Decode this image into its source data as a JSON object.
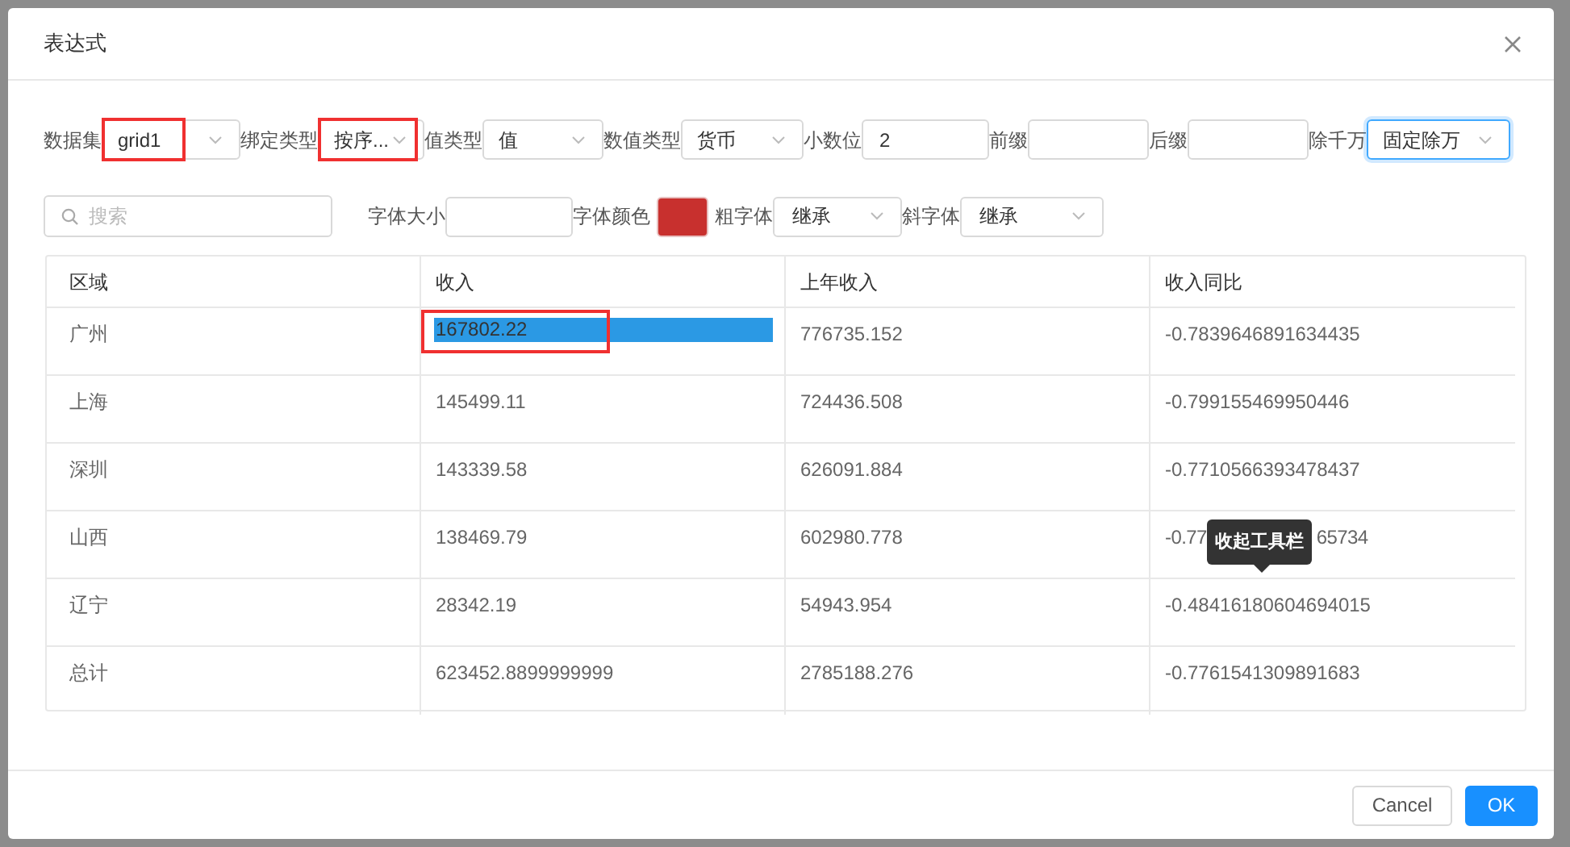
{
  "dialog": {
    "title": "表达式"
  },
  "form_row_1": [
    {
      "label": "数据集",
      "kind": "select",
      "value": "grid1",
      "highlighted": true,
      "focused": false
    },
    {
      "label": "绑定类型",
      "kind": "select",
      "value": "按序...",
      "highlighted": true,
      "focused": false
    },
    {
      "label": "值类型",
      "kind": "select",
      "value": "值",
      "highlighted": false,
      "focused": false
    },
    {
      "label": "数值类型",
      "kind": "select",
      "value": "货币",
      "highlighted": false,
      "focused": false
    },
    {
      "label": "小数位",
      "kind": "input",
      "value": "2",
      "highlighted": false,
      "focused": false
    },
    {
      "label": "前缀",
      "kind": "input",
      "highlighted": false,
      "focused": false
    },
    {
      "label": "后缀",
      "kind": "input",
      "highlighted": false,
      "focused": false
    },
    {
      "label": "除千万",
      "kind": "select",
      "value": "固定除万",
      "highlighted": false,
      "focused": true
    }
  ],
  "search": {
    "placeholder": "搜索"
  },
  "form_row_2": [
    {
      "label": "字体大小",
      "kind": "input"
    },
    {
      "label": "字体颜色",
      "kind": "color",
      "color": "#c8302e"
    },
    {
      "label": "粗字体",
      "kind": "select",
      "value": "继承"
    },
    {
      "label": "斜字体",
      "kind": "select",
      "value": "继承"
    }
  ],
  "table": {
    "columns": [
      "区域",
      "收入",
      "上年收入",
      "收入同比"
    ],
    "rows": [
      [
        {
          "text": "广州",
          "selected": false
        },
        {
          "text": "167802.22",
          "selected": true,
          "highlighted": true
        },
        {
          "text": "776735.152",
          "selected": false
        },
        {
          "text": "-0.7839646891634435",
          "selected": false
        }
      ],
      [
        {
          "text": "上海",
          "selected": false
        },
        {
          "text": "145499.11",
          "selected": false
        },
        {
          "text": "724436.508",
          "selected": false
        },
        {
          "text": "-0.799155469950446",
          "selected": false
        }
      ],
      [
        {
          "text": "深圳",
          "selected": false
        },
        {
          "text": "143339.58",
          "selected": false
        },
        {
          "text": "626091.884",
          "selected": false
        },
        {
          "text": "-0.7710566393478437",
          "selected": false
        }
      ],
      [
        {
          "text": "山西",
          "selected": false
        },
        {
          "text": "138469.79",
          "selected": false
        },
        {
          "text": "602980.778",
          "selected": false
        },
        {
          "parts": [
            "-0.77",
            "65734"
          ],
          "selected": false
        }
      ],
      [
        {
          "text": "辽宁",
          "selected": false
        },
        {
          "text": "28342.19",
          "selected": false
        },
        {
          "text": "54943.954",
          "selected": false
        },
        {
          "text": "-0.48416180604694015",
          "selected": false
        }
      ],
      [
        {
          "text": "总计",
          "selected": false
        },
        {
          "text": "623452.8899999999",
          "selected": false
        },
        {
          "text": "2785188.276",
          "selected": false
        },
        {
          "text": "-0.7761541309891683",
          "selected": false
        }
      ]
    ]
  },
  "tooltip": {
    "text": "收起工具栏"
  },
  "buttons": [
    {
      "label": "Cancel",
      "kind": "default"
    },
    {
      "label": "OK",
      "kind": "primary"
    }
  ]
}
